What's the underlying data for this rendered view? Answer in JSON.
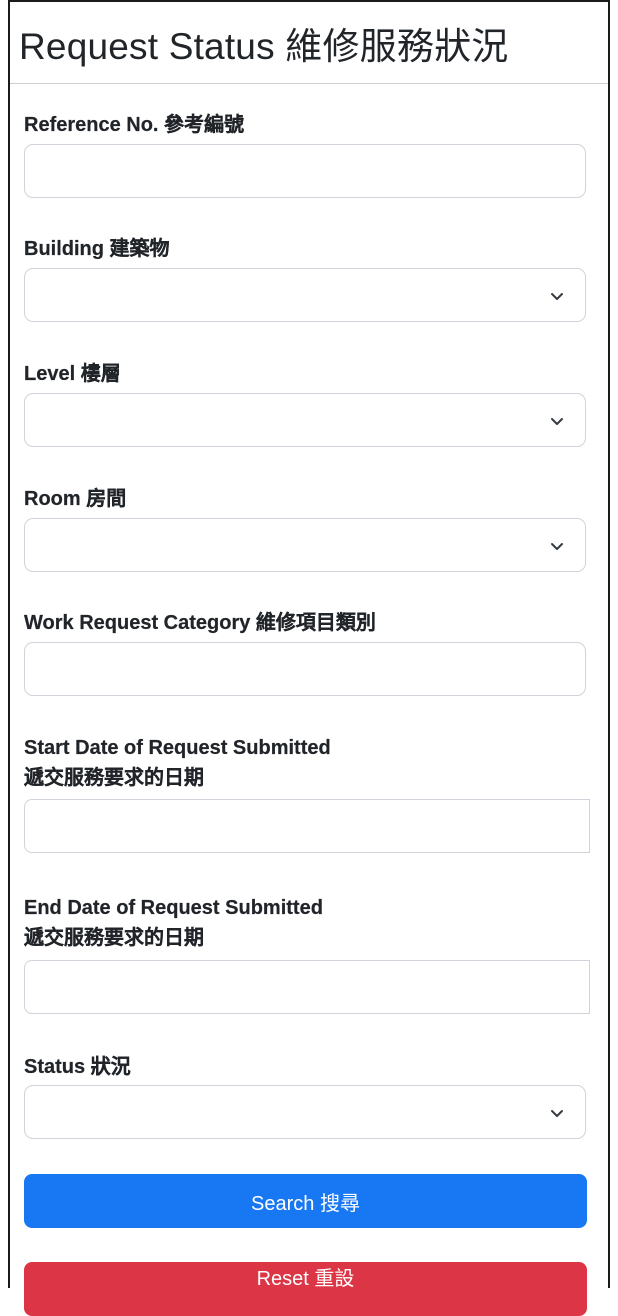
{
  "header": {
    "title": "Request Status 維修服務狀況"
  },
  "fields": {
    "reference": {
      "label": "Reference No. 參考編號",
      "value": ""
    },
    "building": {
      "label": "Building 建築物",
      "value": ""
    },
    "level": {
      "label": "Level 樓層",
      "value": ""
    },
    "room": {
      "label": "Room 房間",
      "value": ""
    },
    "category": {
      "label": "Work Request Category 維修項目類別",
      "value": ""
    },
    "start_date": {
      "label_line1": "Start Date of Request Submitted",
      "label_line2": "遞交服務要求的日期",
      "value": ""
    },
    "end_date": {
      "label_line1": "End Date of Request Submitted",
      "label_line2": "遞交服務要求的日期",
      "value": ""
    },
    "status": {
      "label": "Status 狀況",
      "value": ""
    }
  },
  "buttons": {
    "search_label": "Search 搜尋",
    "reset_label": "Reset 重設"
  },
  "colors": {
    "search_button": "#1877f2",
    "reset_button": "#dc3545",
    "input_border": "#ced4da",
    "text": "#212529"
  },
  "icons": {
    "dropdown": "chevron-down-icon"
  }
}
